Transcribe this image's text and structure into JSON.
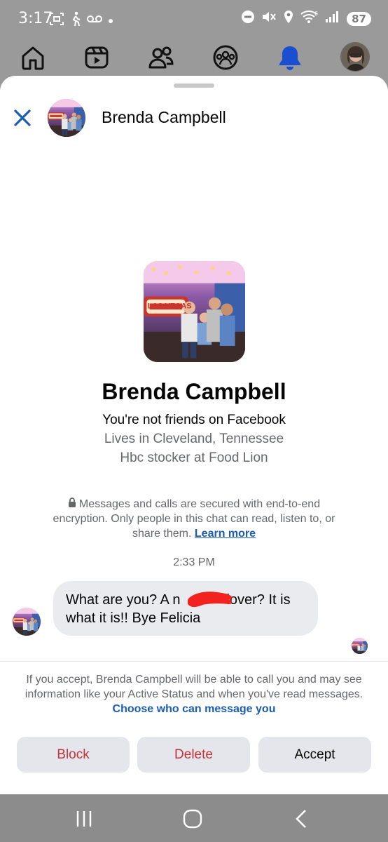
{
  "status_bar": {
    "time": "3:17",
    "battery": "87",
    "signal_label": "6",
    "icons": [
      "screenshot-icon",
      "walking-icon",
      "voicemail-icon",
      "dot-icon",
      "dnd-icon",
      "mute-icon",
      "location-icon",
      "wifi-icon",
      "signal-icon",
      "battery-icon"
    ]
  },
  "fb_nav": {
    "items": [
      "home-icon",
      "reels-icon",
      "friends-icon",
      "groups-icon",
      "notifications-icon",
      "profile-avatar"
    ],
    "active_color": "#1b4fd1"
  },
  "header": {
    "name": "Brenda Campbell"
  },
  "profile": {
    "name": "Brenda Campbell",
    "relationship": "You're not friends on Facebook",
    "lives": "Lives in Cleveland, Tennessee",
    "work": "Hbc stocker at Food Lion",
    "photo_caption": "LAS VEGAS"
  },
  "encryption": {
    "text": "Messages and calls are secured with end-to-end encryption. Only people in this chat can read, listen to, or share them.",
    "link": "Learn more"
  },
  "conversation": {
    "timestamp": "2:33 PM",
    "message_part1": "What are you? A n",
    "message_part2": "lover? It is what it is!! Bye Felicia"
  },
  "request_info": {
    "text": "If you accept, Brenda Campbell will be able to call you and may see information like your Active Status and when you've read messages.",
    "link": "Choose who can message you"
  },
  "actions": {
    "block": "Block",
    "delete": "Delete",
    "accept": "Accept"
  },
  "colors": {
    "accent_blue": "#1b5cb8",
    "danger_red": "#c4323a",
    "bubble_gray": "#e9ebee"
  }
}
